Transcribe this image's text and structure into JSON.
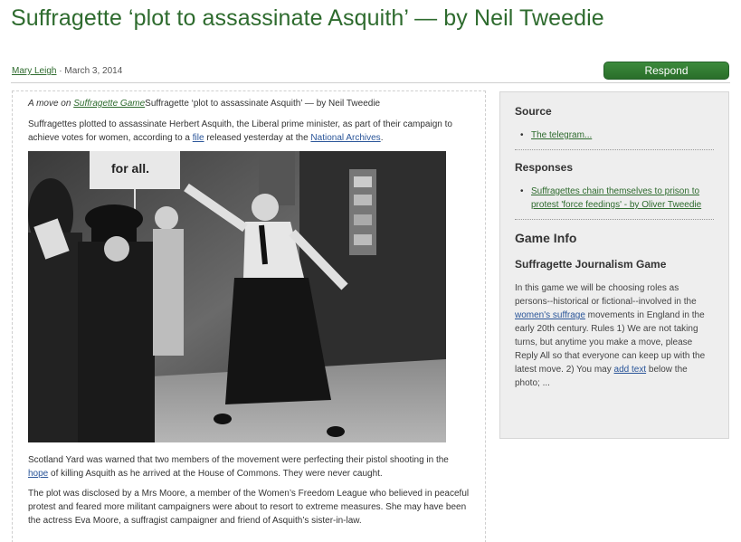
{
  "post": {
    "title": "Suffragette ‘plot to assassinate Asquith’ — by Neil Tweedie",
    "author": "Mary Leigh",
    "date_sep": " · ",
    "date": "March 3, 2014",
    "respond_label": "Respond"
  },
  "main": {
    "move_prefix": "A move on ",
    "game_link": "Suffragette Game",
    "move_title": "Suffragette ‘plot to assassinate Asquith’ — by Neil Tweedie",
    "p1_a": "Suffragettes plotted to assassinate Herbert Asquith, the Liberal prime minister, as part of their campaign to achieve votes for women, according to a ",
    "p1_link1": "file",
    "p1_b": " released yesterday at the ",
    "p1_link2": "National Archives",
    "p1_c": ".",
    "photo_sign": "for all.",
    "p2_a": "Scotland Yard was warned that two members of the movement were perfecting their pistol shooting in the ",
    "p2_link": "hope",
    "p2_b": " of killing Asquith as he arrived at the House of Commons. They were never caught.",
    "p3": "The plot was disclosed by a Mrs Moore, a member of the Women’s Freedom League who believed in peaceful protest and feared more militant campaigners were about to resort to extreme measures. She may have been the actress Eva Moore, a suffragist campaigner and friend of Asquith’s sister-in-law."
  },
  "sidebar": {
    "source_heading": "Source",
    "source_link": "The telegram...",
    "responses_heading": "Responses",
    "response_link": "Suffragettes chain themselves to prison to protest 'force feedings' - by Oliver Tweedie",
    "game_info_heading": "Game Info",
    "game_name": "Suffragette Journalism Game",
    "desc_a": "In this game we will be choosing roles as persons--historical or fictional--involved in the ",
    "desc_link1": "women's suffrage",
    "desc_b": " movements in England in the early 20th century. Rules 1) We are not taking turns, but anytime you make a move, please Reply All so that everyone can keep up with the latest move. 2) You may ",
    "desc_link2": "add text",
    "desc_c": " below the photo; ..."
  },
  "colors": {
    "title_green": "#2e6b2e",
    "button_green": "#2e7d32",
    "link_blue": "#2a5599",
    "sidebar_bg": "#eeeeee"
  }
}
